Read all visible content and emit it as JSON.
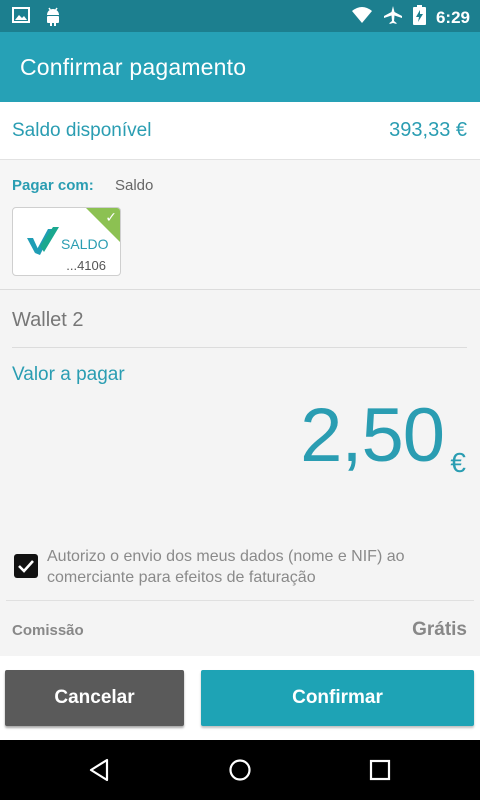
{
  "status_bar": {
    "time": "6:29",
    "left_icons": [
      "image-icon",
      "android-icon"
    ],
    "right_icons": [
      "wifi-icon",
      "airplane-icon",
      "battery-charging-icon"
    ]
  },
  "app_bar": {
    "title": "Confirmar pagamento"
  },
  "balance": {
    "label": "Saldo disponível",
    "value": "393,33 €"
  },
  "payment_method": {
    "label": "Pagar com:",
    "value": "Saldo",
    "card": {
      "name": "SALDO",
      "number": "...4106",
      "selected": true
    }
  },
  "wallet": {
    "name": "Wallet 2"
  },
  "amount": {
    "label": "Valor a pagar",
    "value": "2,50",
    "currency": "€"
  },
  "consent": {
    "checked": true,
    "text": "Autorizo o envio dos meus dados (nome e NIF) ao comerciante para efeitos de faturação"
  },
  "fee": {
    "label": "Comissão",
    "value": "Grátis"
  },
  "actions": {
    "cancel_label": "Cancelar",
    "confirm_label": "Confirmar"
  },
  "navigation": {
    "buttons": [
      "back-icon",
      "home-icon",
      "recents-icon"
    ]
  },
  "colors": {
    "primary": "#26a1b6",
    "primary_dark": "#1c7f8f",
    "accent_text": "#2a9db2",
    "cancel_button": "#5a5a5a",
    "confirm_button": "#1ea3b5",
    "card_check": "#8cc152"
  }
}
